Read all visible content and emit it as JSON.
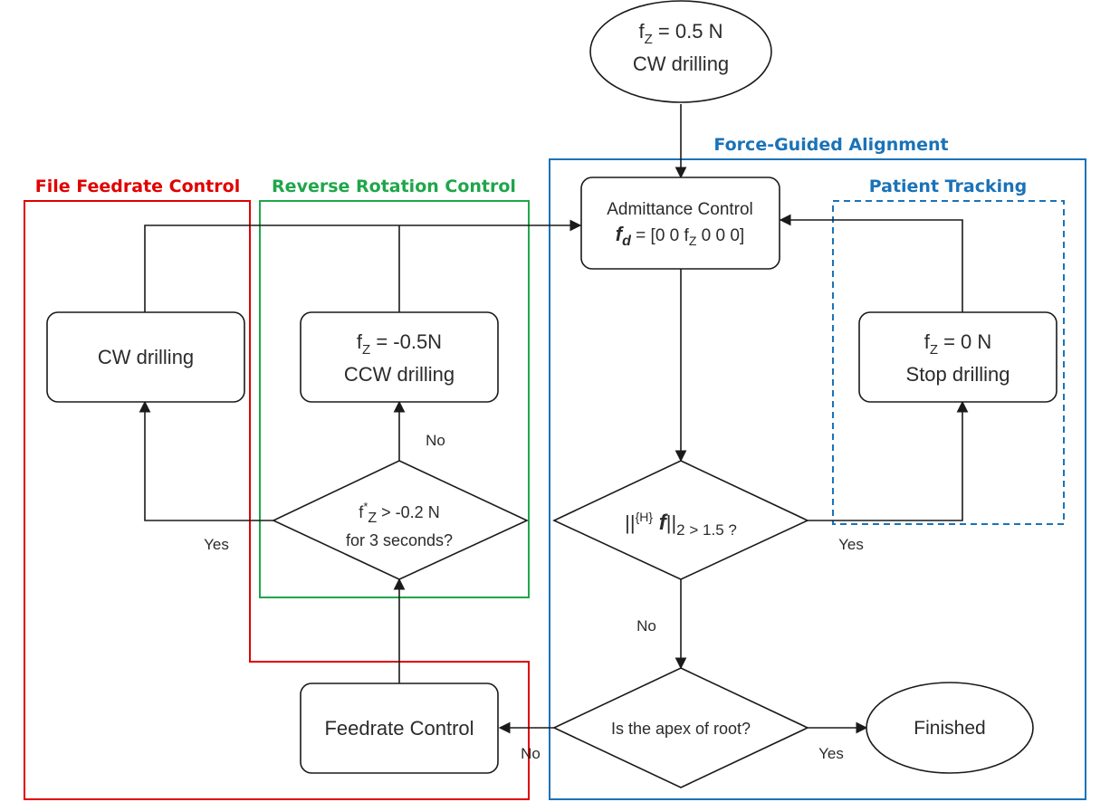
{
  "colors": {
    "file_feedrate": "#e00000",
    "reverse_rotation": "#1fa64a",
    "force_guided": "#1a73b8",
    "patient_tracking": "#1a73b8",
    "stroke": "#1a1a1a"
  },
  "groups": {
    "file_feedrate": "File Feedrate Control",
    "reverse_rotation": "Reverse Rotation Control",
    "force_guided": "Force-Guided Alignment",
    "patient_tracking": "Patient Tracking"
  },
  "nodes": {
    "start": {
      "line1_main": "f",
      "line1_sub": "Z",
      "line1_rest": " = 0.5 N",
      "line2": "CW drilling"
    },
    "admittance": {
      "line1": "Admittance Control",
      "line2_bold": "f",
      "line2_sub": "d",
      "line2_rest": " = [0 0 f",
      "line2_sub2": "Z",
      "line2_end": " 0 0 0]"
    },
    "cw": {
      "label": "CW drilling"
    },
    "ccw": {
      "line1_main": "f",
      "line1_sub": "Z",
      "line1_rest": " = -0.5N",
      "line2": "CCW drilling"
    },
    "stop": {
      "line1_main": "f",
      "line1_sub": "Z",
      "line1_rest": " = 0 N",
      "line2": "Stop drilling"
    },
    "cond_force": {
      "bars_open": "||",
      "sup": "{H}",
      "bold": " f",
      "bars_close": "||",
      "sub": "2",
      "rest": " > 1.5 ?"
    },
    "cond_time": {
      "line1_main": "f",
      "line1_sup": "*",
      "line1_sub": "Z",
      "line1_rest": "  > -0.2 N",
      "line2": "for 3 seconds?"
    },
    "cond_apex": {
      "label": "Is the apex of root?"
    },
    "feedrate": {
      "label": "Feedrate Control"
    },
    "finished": {
      "label": "Finished"
    }
  },
  "edge_labels": {
    "time_yes": "Yes",
    "time_no": "No",
    "force_yes": "Yes",
    "force_no": "No",
    "apex_yes": "Yes",
    "apex_no": "No"
  }
}
